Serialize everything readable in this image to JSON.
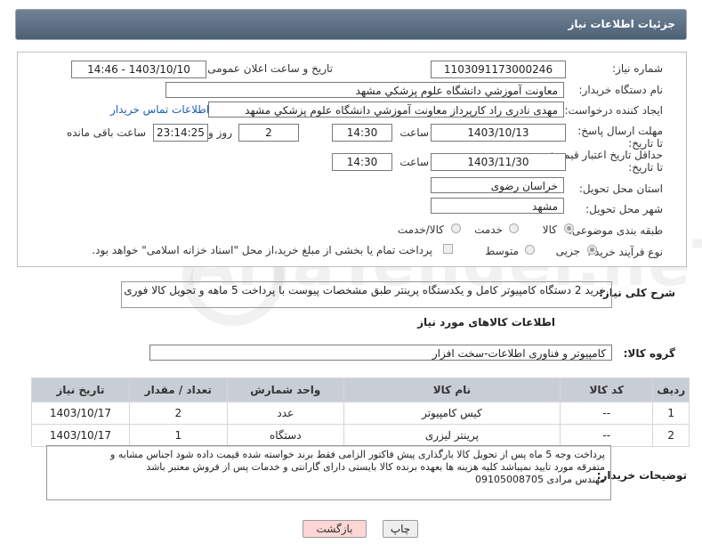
{
  "header": {
    "title": "جزئیات اطلاعات نیاز"
  },
  "form": {
    "need_number_label": "شماره نیاز:",
    "need_number": "1103091173000246",
    "announce_label": "تاریخ و ساعت اعلان عمومی:",
    "announce_value": "1403/10/10 - 14:46",
    "buyer_label": "نام دستگاه خریدار:",
    "buyer_value": "معاونت آموزشي دانشگاه علوم پزشكي مشهد",
    "creator_label": "ایجاد کننده درخواست:",
    "creator_value": "مهدی نادری راد كارپرداز معاونت آموزشي دانشگاه علوم پزشكي مشهد",
    "contact_link": "اطلاعات تماس خریدار",
    "deadline_label": "مهلت ارسال پاسخ: تا تاریخ:",
    "deadline_date": "1403/10/13",
    "time_label": "ساعت",
    "deadline_time": "14:30",
    "days_value": "2",
    "days_label": "روز و",
    "remaining_value": "23:14:25",
    "remaining_label": "ساعت باقی مانده",
    "validity_label": "حداقل تاریخ اعتبار قیمت: تا تاریخ:",
    "validity_date": "1403/11/30",
    "validity_time": "14:30",
    "province_label": "استان محل تحویل:",
    "province_value": "خراسان رضوی",
    "city_label": "شهر محل تحویل:",
    "city_value": "مشهد",
    "category_label": "طبقه بندی موضوعی:",
    "cat_goods": "کالا",
    "cat_service": "خدمت",
    "cat_both": "کالا/خدمت",
    "process_label": "نوع فرآیند خرید :",
    "proc_partial": "جزیی",
    "proc_medium": "متوسط",
    "payment_note": "پرداخت تمام یا بخشی از مبلغ خرید،از محل \"اسناد خزانه اسلامی\" خواهد بود."
  },
  "description": {
    "label": "شرح کلی نیاز:",
    "text": "خرید 2 دستگاه کامپیوتر کامل و یکدستگاه پرینتر طبق مشخصات پیوست با پرداخت 5 ماهه و تحویل کالا فوری"
  },
  "goods_section": {
    "title": "اطلاعات کالاهای مورد نیاز",
    "group_label": "گروه کالا:",
    "group_value": "کامپیوتر و فناوری اطلاعات-سخت افزار"
  },
  "table": {
    "headers": [
      "ردیف",
      "کد کالا",
      "نام کالا",
      "واحد شمارش",
      "تعداد / مقدار",
      "تاریخ نیاز"
    ],
    "rows": [
      [
        "1",
        "--",
        "کیس کامپیوتر",
        "عدد",
        "2",
        "1403/10/17"
      ],
      [
        "2",
        "--",
        "پرینتر لیزری",
        "دستگاه",
        "1",
        "1403/10/17"
      ]
    ]
  },
  "buyer_notes": {
    "label": "توضیحات خریدار:",
    "line1": "پرداخت وجه 5 ماه پس از تحویل کالا بارگذاری پیش فاکتور الزامی فقط برند خواسته شده قیمت داده شود اجناس مشابه و",
    "line2": "متفرقه مورد تایید نمیباشد کلیه هزینه ها بعهده برنده کالا بایستی دارای گارانتی و خدمات پس از فروش معتبر باشد",
    "line3": "مهندس مرادی 09105008705"
  },
  "buttons": {
    "print": "چاپ",
    "back": "بازگشت"
  },
  "watermark": "AriaTender.neT",
  "colors": {
    "header_bg": "#5a6e82",
    "table_header": "#c9ced6",
    "link": "#1a5fb4",
    "back_button": "#ffd6d6"
  }
}
